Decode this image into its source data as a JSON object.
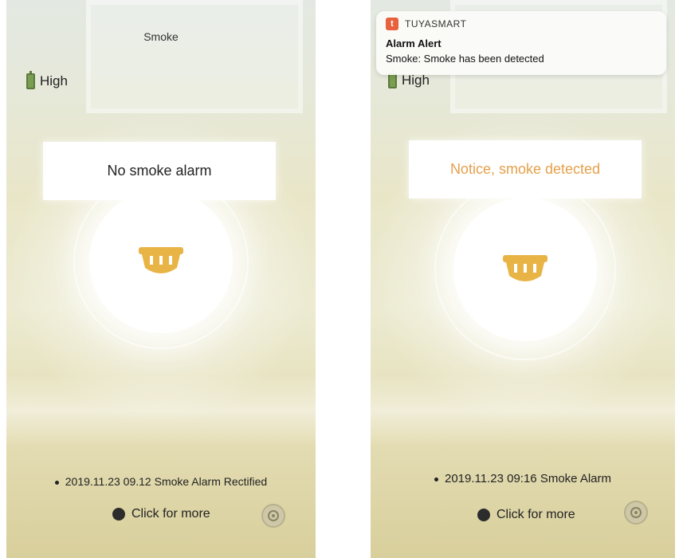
{
  "left_screen": {
    "title": "Smoke",
    "battery_label": "High",
    "status": "No smoke alarm",
    "log_entry": "2019.11.23 09.12 Smoke Alarm Rectified",
    "more_label": "Click for more"
  },
  "right_screen": {
    "battery_label": "High",
    "status": "Notice, smoke detected",
    "log_entry": "2019.11.23 09:16 Smoke Alarm",
    "more_label": "Click for more"
  },
  "notification": {
    "app_name": "TUYASMART",
    "title": "Alarm Alert",
    "body": "Smoke: Smoke has been detected"
  },
  "icons": {
    "battery": "battery-icon",
    "detector": "smoke-detector-icon",
    "settings": "settings-icon",
    "app": "tuyasmart-app-icon"
  },
  "colors": {
    "alert_text": "#e5a04a",
    "detector_icon": "#e9b446",
    "battery": "#7a9d52",
    "app_icon": "#e8603c"
  }
}
